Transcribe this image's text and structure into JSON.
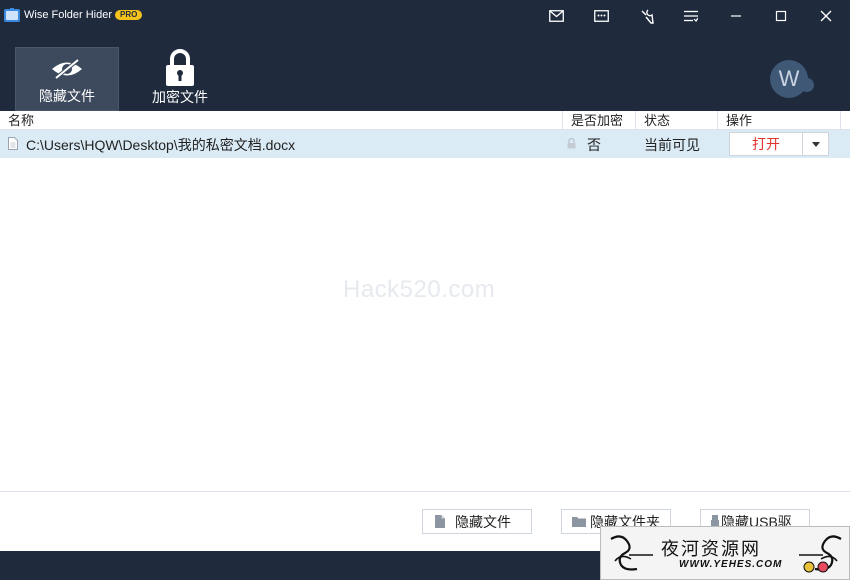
{
  "titlebar": {
    "app_title": "Wise Folder Hider",
    "badge": "PRO",
    "buttons": [
      "mail-icon",
      "feedback-icon",
      "tools-icon",
      "menu-icon",
      "minimize-icon",
      "maximize-icon",
      "close-icon"
    ]
  },
  "toolbar": {
    "tabs": [
      {
        "label": "隐藏文件",
        "icon": "eye-slash-icon",
        "active": true
      },
      {
        "label": "加密文件",
        "icon": "lock-icon",
        "active": false
      }
    ],
    "avatar_letter": "W"
  },
  "table": {
    "columns": [
      "名称",
      "是否加密",
      "状态",
      "操作"
    ],
    "rows": [
      {
        "path": "C:\\Users\\HQW\\Desktop\\我的私密文档.docx",
        "encrypted": "否",
        "status": "当前可见",
        "action": "打开"
      }
    ]
  },
  "watermark": "Hack520.com",
  "actions": [
    {
      "label": "隐藏文件",
      "icon": "file-icon"
    },
    {
      "label": "隐藏文件夹",
      "icon": "folder-icon"
    },
    {
      "label": "隐藏USB驱",
      "icon": "usb-icon"
    }
  ],
  "overlay": {
    "title": "夜河资源网",
    "url": "WWW.YEHES.COM"
  },
  "colors": {
    "chrome": "#1f2a3d",
    "active_tab": "#3d4a5d",
    "row_selected": "#daebf6",
    "action_text": "#e0332a",
    "badge": "#f4c21b"
  }
}
